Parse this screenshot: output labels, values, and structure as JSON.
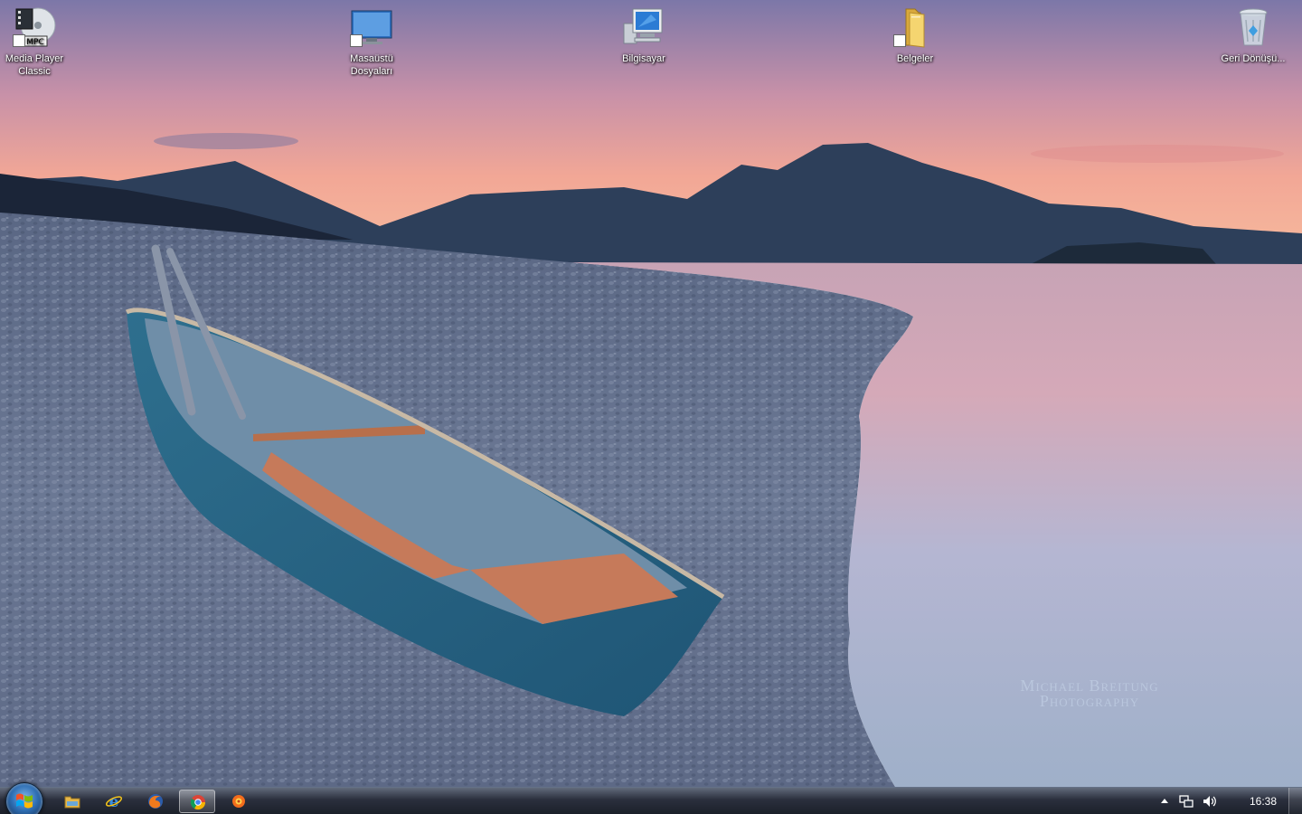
{
  "desktop_icons": [
    {
      "label": "Media Player Classic",
      "icon": "media-player-classic-icon",
      "shortcut": true
    },
    {
      "label": "Masaüstü Dosyaları",
      "icon": "monitor-folder-icon",
      "shortcut": true
    },
    {
      "label": "Bilgisayar",
      "icon": "computer-icon",
      "shortcut": false
    },
    {
      "label": "Belgeler",
      "icon": "folder-icon",
      "shortcut": true
    },
    {
      "label": "Geri Dönüşü...",
      "icon": "recycle-bin-icon",
      "shortcut": false
    }
  ],
  "watermark": {
    "line1": "Michael Breitung",
    "line2": "Photography"
  },
  "taskbar": {
    "start_icon": "windows-logo-icon",
    "pinned": [
      {
        "icon": "windows-explorer-icon",
        "active": false
      },
      {
        "icon": "internet-explorer-icon",
        "active": false
      },
      {
        "icon": "firefox-icon",
        "active": false
      },
      {
        "icon": "chrome-icon",
        "active": true
      },
      {
        "icon": "firefox-nightly-icon",
        "active": false
      }
    ],
    "tray": {
      "icons": [
        "show-hidden-icons-arrow-icon",
        "network-icon",
        "volume-icon"
      ],
      "clock": "16:38"
    }
  },
  "colors": {
    "taskbar": "#1a2030",
    "sky_top": "#8a7fb0",
    "sky_glow": "#f3a79a",
    "water": "#b4b9d6",
    "boat_hull": "#2f7393"
  }
}
